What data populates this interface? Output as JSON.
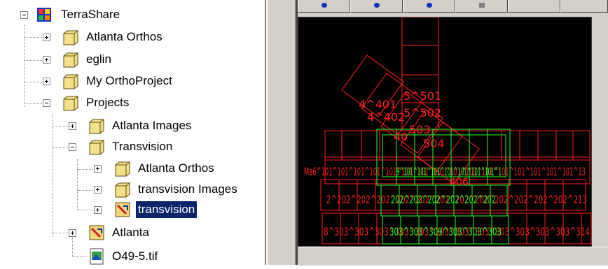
{
  "tree": {
    "root": {
      "label": "TerraShare"
    },
    "items": {
      "atlanta_orthos": {
        "label": "Atlanta Orthos"
      },
      "eglin": {
        "label": "eglin"
      },
      "my_orthoproject": {
        "label": "My OrthoProject"
      },
      "projects": {
        "label": "Projects"
      },
      "atlanta_images": {
        "label": "Atlanta Images"
      },
      "transvision_folder": {
        "label": "Transvision"
      },
      "tv_atlanta_orthos": {
        "label": "Atlanta Orthos"
      },
      "transvision_images": {
        "label": "transvision Images"
      },
      "transvision_project": {
        "label": "transvision"
      },
      "atlanta_project": {
        "label": "Atlanta"
      },
      "tif_file": {
        "label": "O49-5.tif"
      }
    }
  },
  "map": {
    "labels": {
      "l1": "5^501",
      "l2": "4^401",
      "l3": "5^502",
      "l4": "4^402",
      "l5": "503",
      "l6": "504",
      "l7": "40",
      "row1": "Ma6^101^101^101^101^101^101^101^101^101^101^101^101^101^101^101^101^13",
      "row1g": "9^101^101^101^101^101^101^101^1",
      "row2": "2^202^202^202^202^202^202^202^202^202^202^202^202^213",
      "row2g": "202^202^202^202^202^202",
      "row3": "8^303^303^303^303^303^303^303^303^303^303^303^303^314",
      "row3g": "303^303^309^303^303^303",
      "mid": "406"
    }
  },
  "colors": {
    "selection": "#0a246a",
    "map_red": "#ff2020",
    "map_green": "#22ff22",
    "canvas_bg": "#000000",
    "panel": "#d4d0c8"
  },
  "icons": {
    "root": "terrashare-icon",
    "folder": "folder-icon",
    "project": "project-icon",
    "file": "image-file-icon"
  }
}
